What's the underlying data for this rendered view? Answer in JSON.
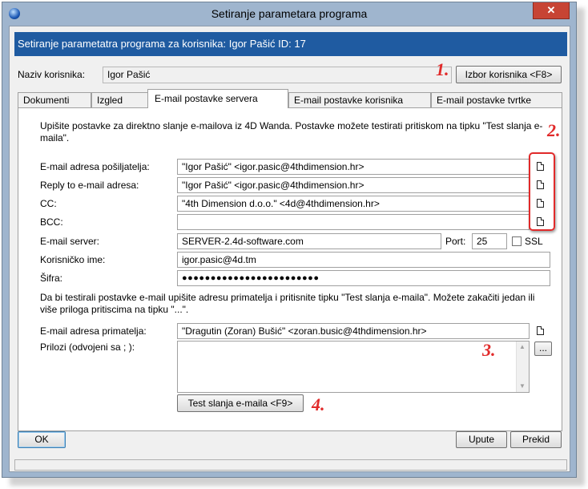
{
  "window": {
    "title": "Setiranje parametara programa",
    "close_glyph": "✕"
  },
  "header": {
    "text": "Setiranje parametatra programa za korisnika: Igor Pašić ID: 17"
  },
  "user": {
    "label": "Naziv korisnika:",
    "value": "Igor Pašić",
    "select_button": "Izbor korisnika <F8>"
  },
  "tabs": [
    {
      "label": "Dokumenti"
    },
    {
      "label": "Izgled"
    },
    {
      "label": "E-mail postavke servera"
    },
    {
      "label": "E-mail postavke korisnika"
    },
    {
      "label": "E-mail postavke tvrtke"
    }
  ],
  "panel": {
    "intro": "Upišite postavke za direktno slanje e-mailova iz 4D Wanda. Postavke možete testirati pritiskom na tipku \"Test slanja e-maila\".",
    "fields": {
      "sender_label": "E-mail adresa pošiljatelja:",
      "sender_value": "\"Igor Pašić\" <igor.pasic@4thdimension.hr>",
      "reply_label": "Reply to e-mail adresa:",
      "reply_value": "\"Igor Pašić\" <igor.pasic@4thdimension.hr>",
      "cc_label": "CC:",
      "cc_value": "\"4th Dimension d.o.o.\" <4d@4thdimension.hr>",
      "bcc_label": "BCC:",
      "bcc_value": "",
      "server_label": "E-mail server:",
      "server_value": "SERVER-2.4d-software.com",
      "port_label": "Port:",
      "port_value": "25",
      "ssl_label": "SSL",
      "username_label": "Korisničko ime:",
      "username_value": "igor.pasic@4d.tm",
      "password_label": "Šifra:",
      "password_value": "●●●●●●●●●●●●●●●●●●●●●●●●"
    },
    "test_intro": "Da bi testirali postavke e-mail upišite adresu primatelja i pritisnite tipku \"Test slanja e-maila\". Možete zakačiti jedan ili više priloga pritiscima na tipku \"...\".",
    "recipient_label": "E-mail adresa primatelja:",
    "recipient_value": "\"Dragutin (Zoran) Bušić\" <zoran.busic@4thdimension.hr>",
    "attachments_label": "Prilozi (odvojeni sa ; ):",
    "attachments_value": "",
    "browse_button": "...",
    "test_button": "Test slanja e-maila <F9>"
  },
  "annotations": [
    "1.",
    "2.",
    "3.",
    "4."
  ],
  "footer": {
    "ok_button": "OK",
    "help_button": "Upute",
    "cancel_button": "Prekid"
  },
  "icons": {
    "app": "app-globe-icon",
    "document": "document-icon"
  },
  "colors": {
    "header_band": "#1f5ba1",
    "annotation_red": "#e12a2a",
    "close_button": "#c74434"
  }
}
